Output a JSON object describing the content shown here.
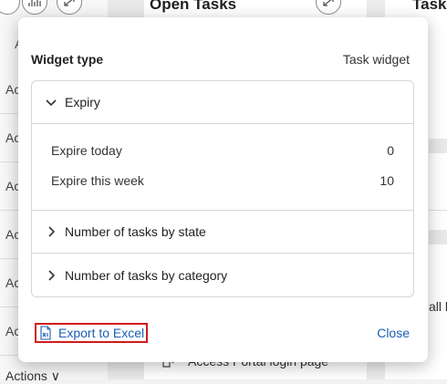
{
  "background": {
    "left_header_fragment": "Ac",
    "left_rows": [
      "Ac",
      "Ac",
      "Ac",
      "Ac",
      "Ac",
      "Ac"
    ],
    "actions_label": "Actions ∨",
    "open_tasks_title": "Open Tasks",
    "tasks_title": "Tasks",
    "login_item": "Access Portal login page",
    "right_fragment": "all b"
  },
  "dialog": {
    "title": "Widget type",
    "widget_type_value": "Task widget",
    "sections": [
      {
        "label": "Expiry",
        "expanded": true,
        "rows": [
          {
            "label": "Expire today",
            "value": "0"
          },
          {
            "label": "Expire this week",
            "value": "10"
          }
        ]
      },
      {
        "label": "Number of tasks by state",
        "expanded": false
      },
      {
        "label": "Number of tasks by category",
        "expanded": false
      }
    ],
    "export_label": "Export to Excel",
    "close_label": "Close"
  },
  "colors": {
    "link": "#1a5fb4",
    "highlight_border": "#d11a1a"
  }
}
